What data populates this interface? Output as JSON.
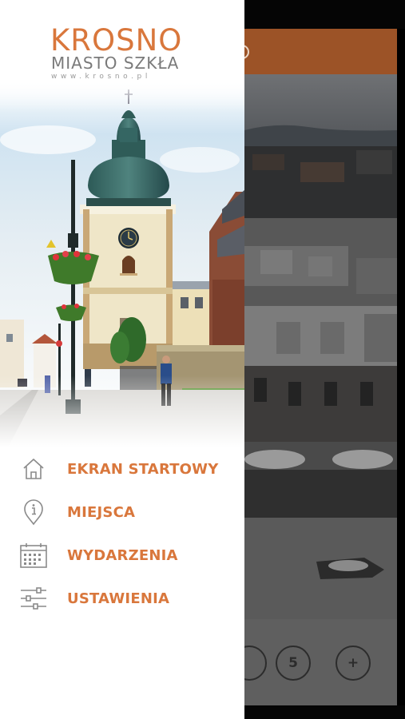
{
  "logo": {
    "title": "KROSNO",
    "subtitle": "MIASTO SZKŁA",
    "url": "www.krosno.pl"
  },
  "menu": {
    "items": [
      {
        "label": "EKRAN STARTOWY",
        "icon": "home-icon"
      },
      {
        "label": "MIEJSCA",
        "icon": "info-location-icon"
      },
      {
        "label": "WYDARZENIA",
        "icon": "calendar-icon"
      },
      {
        "label": "USTAWIENIA",
        "icon": "sliders-icon"
      }
    ]
  },
  "background_app": {
    "buttons": [
      {
        "label": "5"
      },
      {
        "label": "+"
      }
    ]
  },
  "colors": {
    "accent": "#d9773c",
    "header": "#9c5327",
    "icon_gray": "#8a8a8a"
  }
}
